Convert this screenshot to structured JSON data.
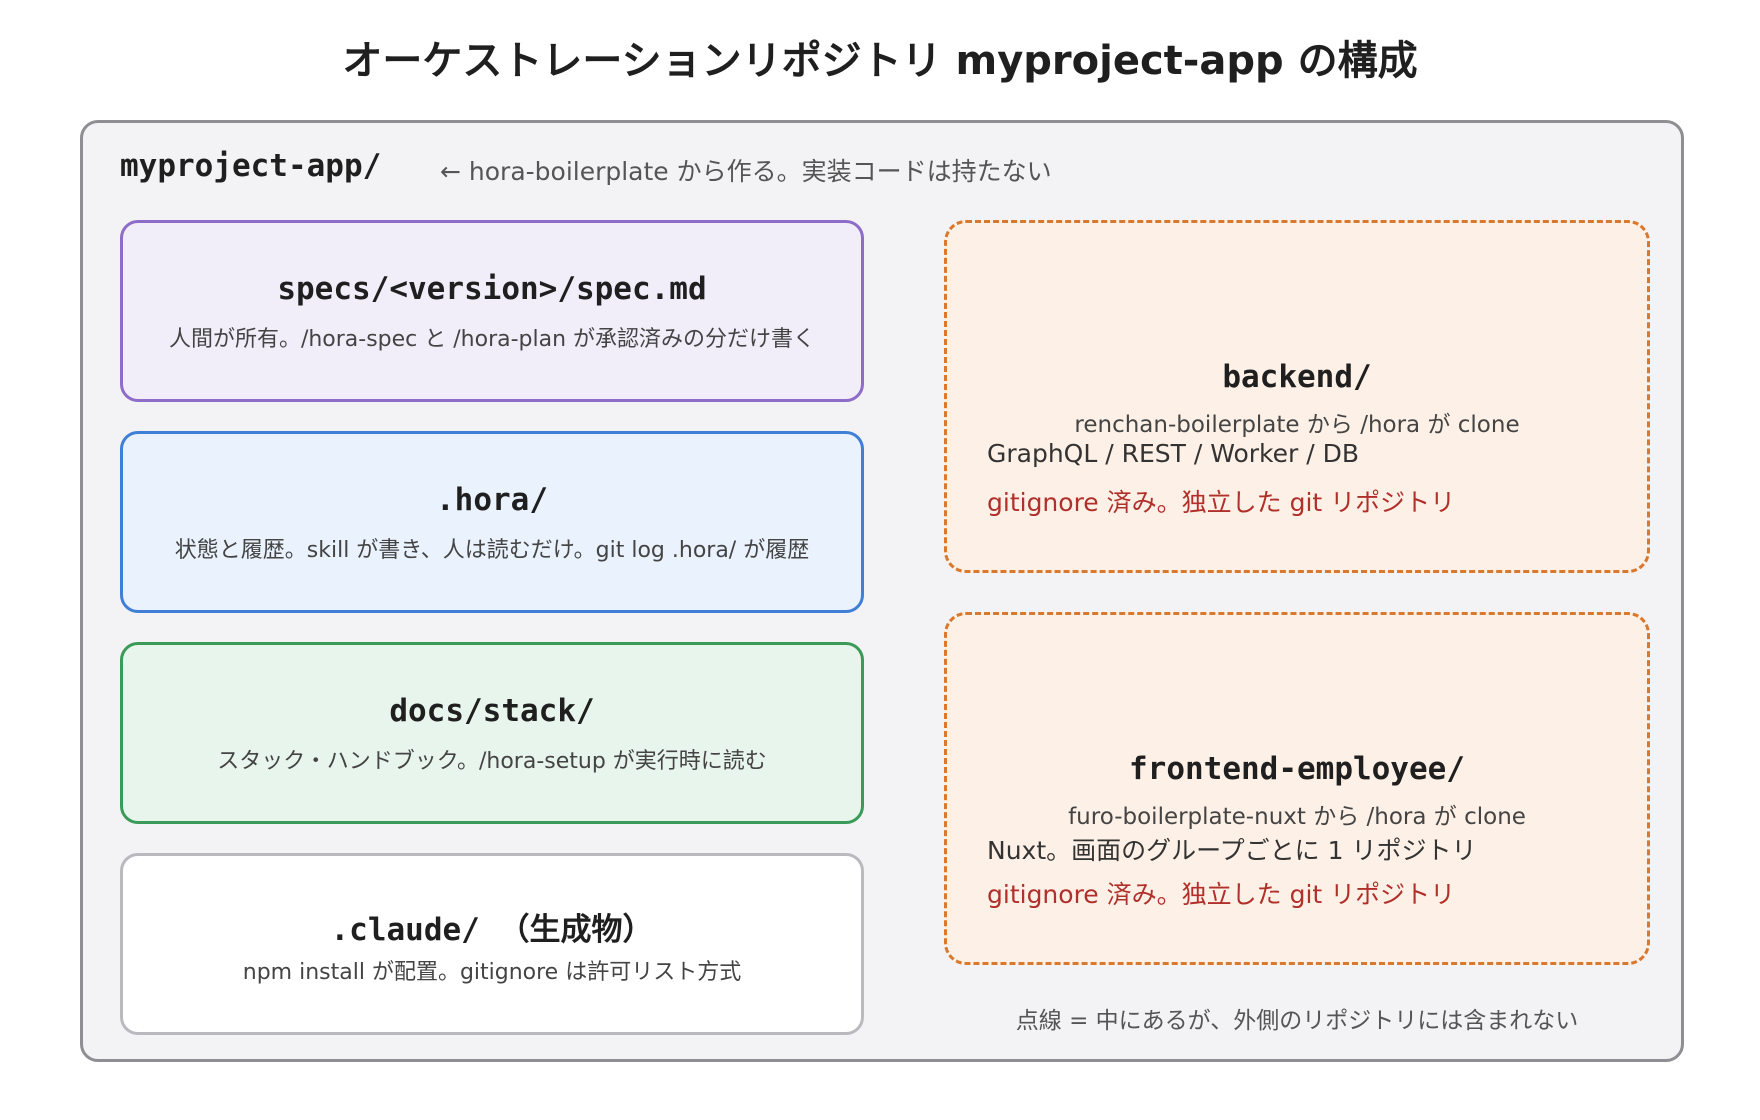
{
  "title": "オーケストレーションリポジトリ myproject-app の構成",
  "root": {
    "name": "myproject-app/",
    "note": "← hora-boilerplate から作る。実装コードは持たない"
  },
  "inner": {
    "specs": {
      "name": "specs/<version>/spec.md",
      "desc": "人間が所有。/hora-spec と /hora-plan が承認済みの分だけ書く"
    },
    "hora": {
      "name": ".hora/",
      "desc": "状態と履歴。skill が書き、人は読むだけ。git log .hora/ が履歴"
    },
    "docs": {
      "name": "docs/stack/",
      "desc": "スタック・ハンドブック。/hora-setup が実行時に読む"
    },
    "claude": {
      "name": ".claude/ （生成物）",
      "desc": "npm install が配置。gitignore は許可リスト方式"
    }
  },
  "external": {
    "backend": {
      "name": "backend/",
      "source": "renchan-boilerplate から /hora が clone",
      "tech": "GraphQL / REST / Worker / DB",
      "ignore": "gitignore 済み。独立した git リポジトリ"
    },
    "frontend": {
      "name": "frontend-employee/",
      "source": "furo-boilerplate-nuxt から /hora が clone",
      "tech": "Nuxt。画面のグループごとに 1 リポジトリ",
      "ignore": "gitignore 済み。独立した git リポジトリ"
    }
  },
  "legend": "点線 = 中にあるが、外側のリポジトリには含まれない",
  "colors": {
    "specs": "#8e6cc7",
    "hora": "#3f7fd6",
    "docs": "#3a9a58",
    "claude": "#b9b9be",
    "external": "#d9782f",
    "ignore_text": "#b0302a"
  }
}
